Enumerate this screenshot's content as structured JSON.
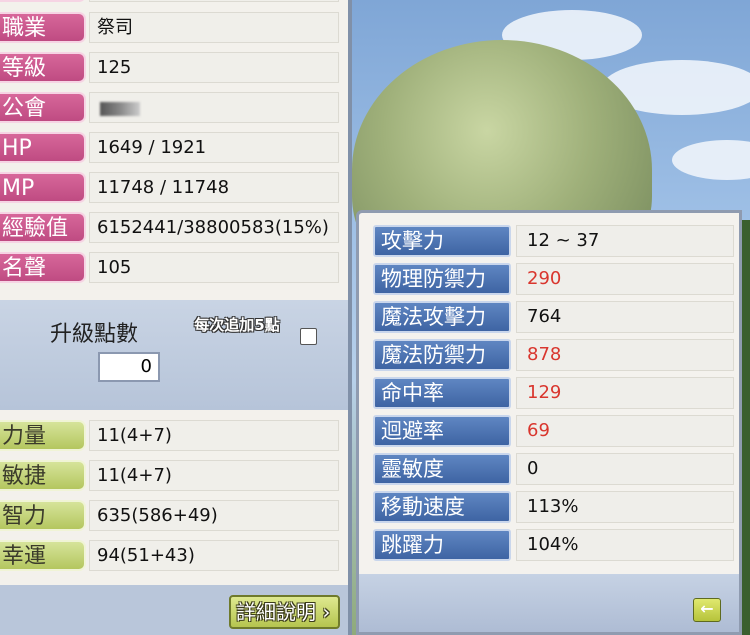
{
  "profile": {
    "job": {
      "label": "職業",
      "value": "祭司"
    },
    "level": {
      "label": "等級",
      "value": "125"
    },
    "guild": {
      "label": "公會",
      "value": ""
    },
    "hp": {
      "label": "HP",
      "value": "1649 / 1921"
    },
    "mp": {
      "label": "MP",
      "value": "11748 / 11748"
    },
    "exp": {
      "label": "經驗值",
      "value": "6152441/38800583(15%)"
    },
    "fame": {
      "label": "名聲",
      "value": "105"
    }
  },
  "points": {
    "label": "升級點數",
    "value": "0",
    "auto_label": "每次追加5點",
    "auto_checked": false
  },
  "stats": {
    "str": {
      "label": "力量",
      "value": "11(4+7)"
    },
    "dex": {
      "label": "敏捷",
      "value": "11(4+7)"
    },
    "int": {
      "label": "智力",
      "value": "635(586+49)"
    },
    "luk": {
      "label": "幸運",
      "value": "94(51+43)"
    }
  },
  "detail_button": "詳細說明",
  "combat": [
    {
      "label": "攻擊力",
      "value": "12 ~ 37",
      "red": false
    },
    {
      "label": "物理防禦力",
      "value": "290",
      "red": true
    },
    {
      "label": "魔法攻擊力",
      "value": "764",
      "red": false
    },
    {
      "label": "魔法防禦力",
      "value": "878",
      "red": true
    },
    {
      "label": "命中率",
      "value": "129",
      "red": true
    },
    {
      "label": "迴避率",
      "value": "69",
      "red": true
    },
    {
      "label": "靈敏度",
      "value": "0",
      "red": false
    },
    {
      "label": "移動速度",
      "value": "113%",
      "red": false
    },
    {
      "label": "跳躍力",
      "value": "104%",
      "red": false
    }
  ],
  "colors": {
    "accent_red": "#d9362e",
    "label_pink": "#c9528a",
    "label_green": "#c3d36f",
    "label_blue": "#4a6fae"
  }
}
